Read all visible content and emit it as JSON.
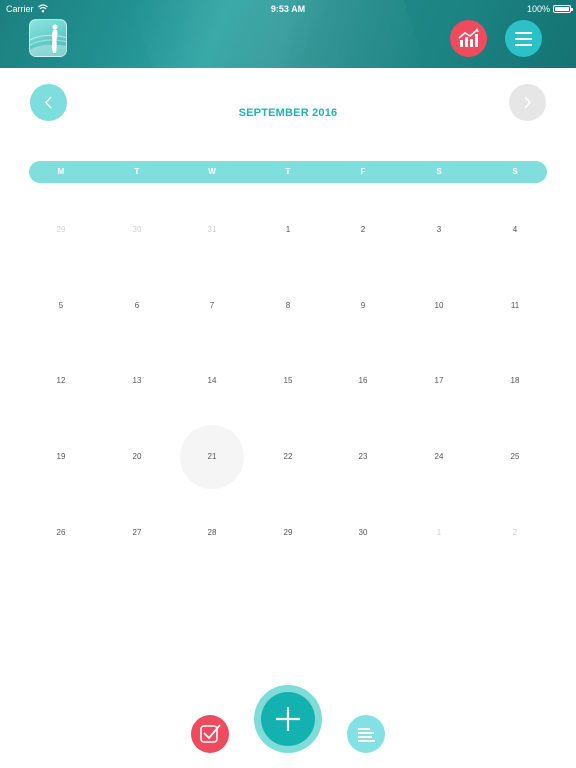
{
  "status_bar": {
    "carrier": "Carrier",
    "time": "9:53 AM",
    "battery": "100%"
  },
  "header": {
    "logo_icon": "woman-silhouette-logo-icon",
    "stats_icon": "chart-icon",
    "menu_icon": "hamburger-menu-icon",
    "colors": {
      "header": "#1f8a8a",
      "stats": "#ef4b5f",
      "menu": "#2bc1c6"
    }
  },
  "calendar": {
    "month_title": "SEPTEMBER 2016",
    "prev_icon": "chevron-left-icon",
    "next_icon": "chevron-right-icon",
    "weekdays": [
      "M",
      "T",
      "W",
      "T",
      "F",
      "S",
      "S"
    ],
    "weeks": [
      [
        "29",
        "30",
        "31",
        "1",
        "2",
        "3",
        "4"
      ],
      [
        "5",
        "6",
        "7",
        "8",
        "9",
        "10",
        "11"
      ],
      [
        "12",
        "13",
        "14",
        "15",
        "16",
        "17",
        "18"
      ],
      [
        "19",
        "20",
        "21",
        "22",
        "23",
        "24",
        "25"
      ],
      [
        "26",
        "27",
        "28",
        "29",
        "30",
        "1",
        "2"
      ]
    ],
    "today": "21",
    "accent": "#1fb3b3"
  },
  "bottom_bar": {
    "checklist_icon": "checkbox-icon",
    "add_icon": "plus-icon",
    "notes_icon": "notes-list-icon",
    "colors": {
      "checklist": "#ef4b5f",
      "add": "#14b1b1",
      "notes": "#83e1e4"
    }
  }
}
